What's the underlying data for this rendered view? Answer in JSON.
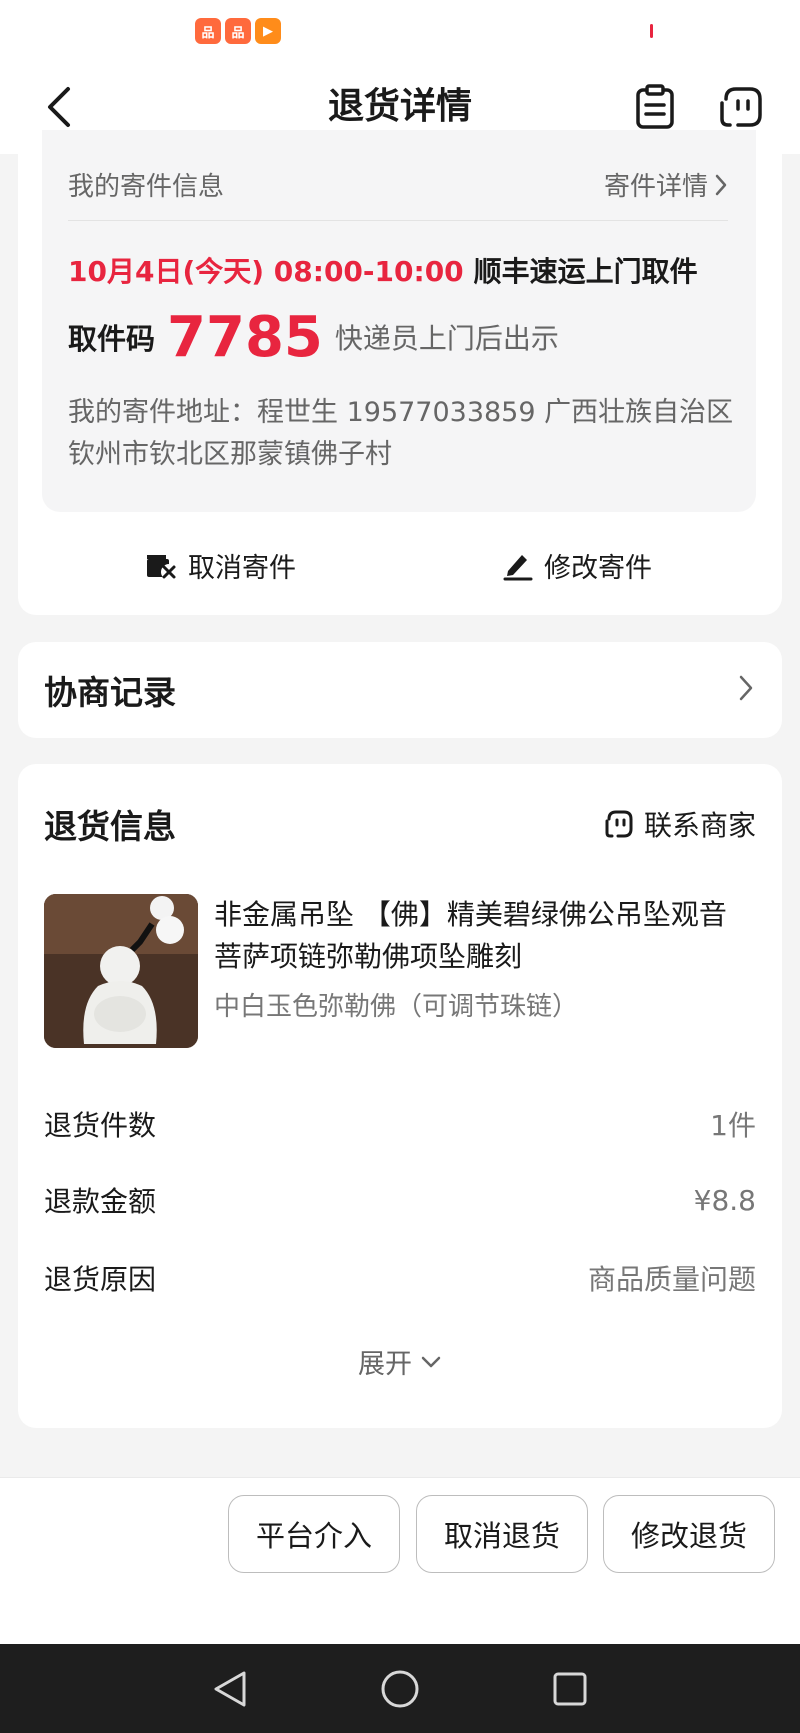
{
  "status_bar": {
    "icons": [
      "app-icon-1",
      "app-icon-2",
      "video-app-icon"
    ],
    "icon_glyphs": [
      "品",
      "品",
      "▶"
    ]
  },
  "header": {
    "title": "退货详情",
    "back_icon": "chevron-left-icon",
    "action_icons": [
      "clipboard-icon",
      "customer-service-icon"
    ]
  },
  "shipping": {
    "section_label": "我的寄件信息",
    "detail_link": "寄件详情",
    "pickup_time": "10月4日(今天) 08:00-10:00",
    "pickup_method": "顺丰速运上门取件",
    "code_label": "取件码",
    "code_value": "7785",
    "code_tip": "快递员上门后出示",
    "address": "我的寄件地址：程世生 19577033859 广西壮族自治区钦州市钦北区那蒙镇佛子村",
    "actions": {
      "cancel": "取消寄件",
      "modify": "修改寄件"
    }
  },
  "negotiation": {
    "title": "协商记录"
  },
  "return_info": {
    "title": "退货信息",
    "contact_label": "联系商家",
    "product": {
      "name": "非金属吊坠 【佛】精美碧绿佛公吊坠观音菩萨项链弥勒佛项坠雕刻",
      "spec": "中白玉色弥勒佛（可调节珠链）"
    },
    "rows": [
      {
        "key": "退货件数",
        "value": "1件"
      },
      {
        "key": "退款金额",
        "value": "¥8.8"
      },
      {
        "key": "退货原因",
        "value": "商品质量问题"
      }
    ],
    "expand_label": "展开"
  },
  "bottom_actions": {
    "platform": "平台介入",
    "cancel_return": "取消退货",
    "modify_return": "修改退货"
  },
  "colors": {
    "accent_red": "#e8253f",
    "text_main": "#1a1a1a",
    "text_secondary": "#666666",
    "page_bg": "#f4f4f4"
  }
}
